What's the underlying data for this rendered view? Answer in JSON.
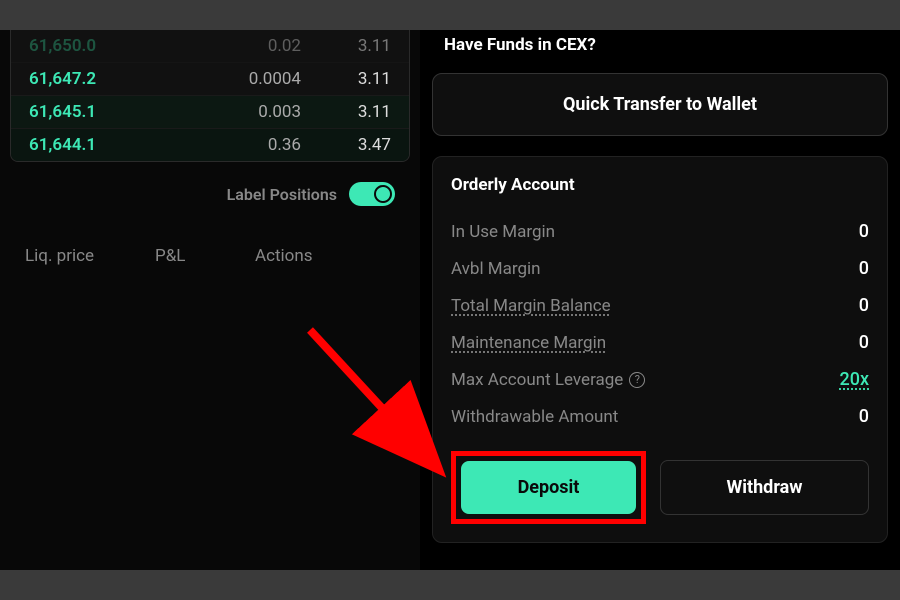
{
  "orderbook": {
    "rows": [
      {
        "price": "61,650.0",
        "amount": "0.02",
        "total": "3.11"
      },
      {
        "price": "61,647.2",
        "amount": "0.0004",
        "total": "3.11"
      },
      {
        "price": "61,645.1",
        "amount": "0.003",
        "total": "3.11"
      },
      {
        "price": "61,644.1",
        "amount": "0.36",
        "total": "3.47"
      }
    ]
  },
  "labelPositions": {
    "text": "Label Positions",
    "on": true
  },
  "positionsHeader": {
    "liqPrice": "Liq. price",
    "pnl": "P&L",
    "actions": "Actions"
  },
  "cex": {
    "haveFunds": "Have Funds in CEX?",
    "quickTransfer": "Quick Transfer to Wallet"
  },
  "account": {
    "title": "Orderly Account",
    "rows": [
      {
        "label": "In Use Margin",
        "value": "0",
        "underline": false,
        "help": false,
        "leverage": false
      },
      {
        "label": "Avbl Margin",
        "value": "0",
        "underline": false,
        "help": false,
        "leverage": false
      },
      {
        "label": "Total Margin Balance",
        "value": "0",
        "underline": true,
        "help": false,
        "leverage": false
      },
      {
        "label": "Maintenance Margin",
        "value": "0",
        "underline": true,
        "help": false,
        "leverage": false
      },
      {
        "label": "Max Account Leverage",
        "value": "20x",
        "underline": false,
        "help": true,
        "leverage": true
      },
      {
        "label": "Withdrawable Amount",
        "value": "0",
        "underline": false,
        "help": false,
        "leverage": false
      }
    ],
    "deposit": "Deposit",
    "withdraw": "Withdraw"
  }
}
